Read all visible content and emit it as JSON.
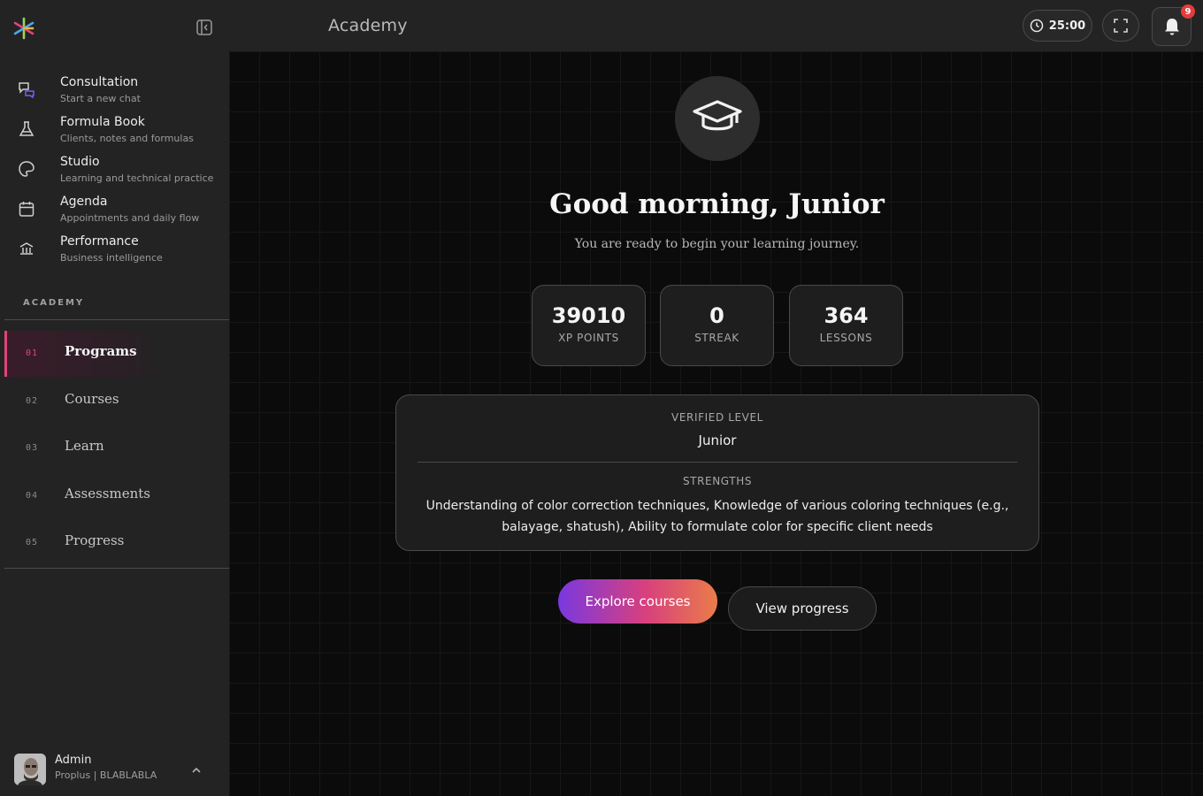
{
  "header": {
    "title": "Academy",
    "timer": "25:00",
    "notifications_count": "9"
  },
  "sidebar": {
    "items": [
      {
        "label": "Consultation",
        "sub": "Start a new chat",
        "icon": "chat-bubbles-icon"
      },
      {
        "label": "Formula Book",
        "sub": "Clients, notes and formulas",
        "icon": "flask-icon"
      },
      {
        "label": "Studio",
        "sub": "Learning and technical practice",
        "icon": "palette-icon"
      },
      {
        "label": "Agenda",
        "sub": "Appointments and daily flow",
        "icon": "calendar-icon"
      },
      {
        "label": "Performance",
        "sub": "Business intelligence",
        "icon": "bank-icon"
      }
    ],
    "section_label": "ACADEMY",
    "academy_items": [
      {
        "num": "01",
        "label": "Programs",
        "active": true
      },
      {
        "num": "02",
        "label": "Courses"
      },
      {
        "num": "03",
        "label": "Learn"
      },
      {
        "num": "04",
        "label": "Assessments"
      },
      {
        "num": "05",
        "label": "Progress"
      }
    ],
    "user": {
      "name": "Admin",
      "role": "Proplus | BLABLABLA"
    }
  },
  "main": {
    "greeting": "Good morning, Junior",
    "subtitle": "You are ready to begin your learning journey.",
    "stats": [
      {
        "value": "39010",
        "label": "XP POINTS"
      },
      {
        "value": "0",
        "label": "STREAK"
      },
      {
        "value": "364",
        "label": "LESSONS"
      }
    ],
    "level_card": {
      "level_label": "VERIFIED LEVEL",
      "level_value": "Junior",
      "strengths_label": "STRENGTHS",
      "strengths": "Understanding of color correction techniques, Knowledge of various coloring techniques (e.g., balayage, shatush), Ability to formulate color for specific client needs"
    },
    "primary_button": "Explore courses",
    "secondary_button": "View progress"
  },
  "colors": {
    "accent_pink": "#e0457b",
    "gradient_start": "#7a38e0",
    "gradient_end": "#ea7c4a",
    "badge_red": "#e33c3c"
  }
}
